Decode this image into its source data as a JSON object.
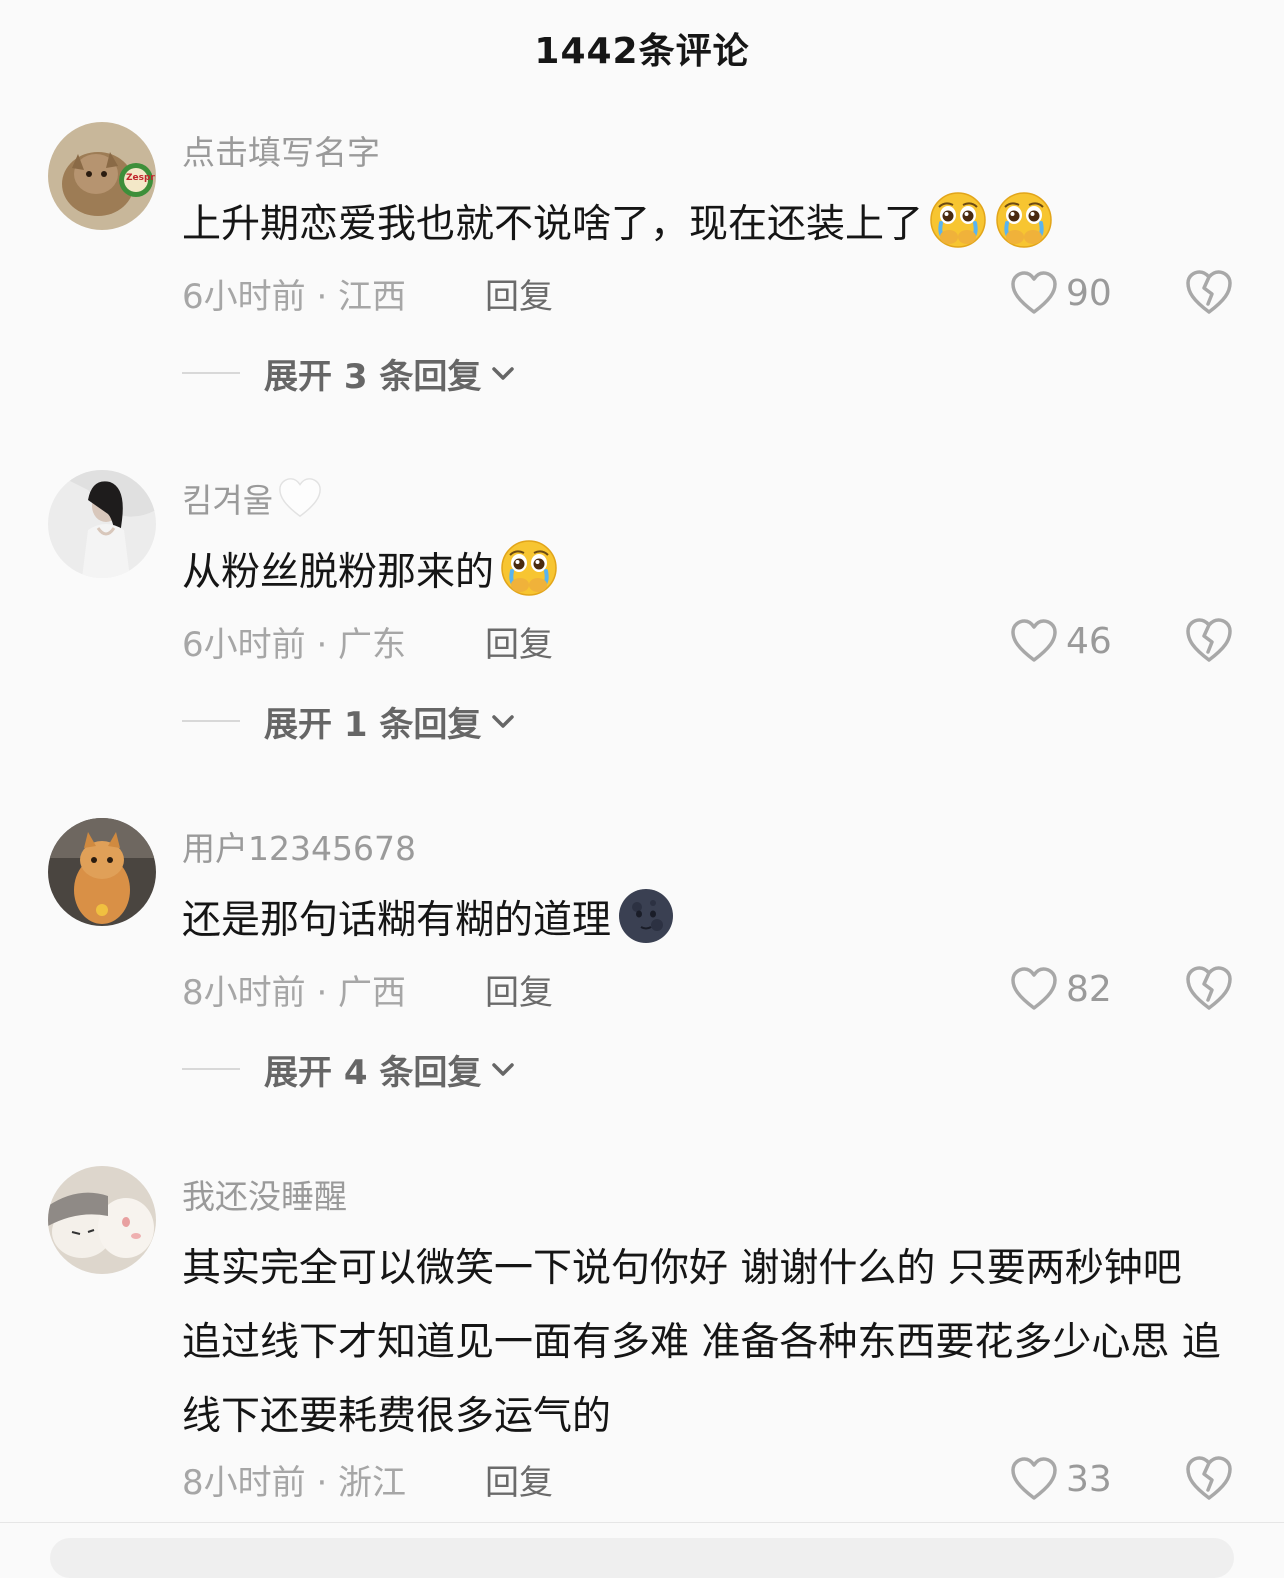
{
  "header": {
    "title": "1442条评论"
  },
  "comments": [
    {
      "username": "点击填写名字",
      "text": "上升期恋爱我也就不说啥了，现在还装上了",
      "emojis": [
        "pleading-face-icon",
        "pleading-face-icon"
      ],
      "time_location": "6小时前 · 江西",
      "reply_label": "回复",
      "likes": "90",
      "expand_label": "展开 3 条回复"
    },
    {
      "username": "킴겨울",
      "username_emoji": "white-heart-icon",
      "text": "从粉丝脱粉那来的",
      "emojis": [
        "pleading-face-icon"
      ],
      "time_location": "6小时前 · 广东",
      "reply_label": "回复",
      "likes": "46",
      "expand_label": "展开 1 条回复"
    },
    {
      "username": "用户12345678",
      "text": "还是那句话糊有糊的道理",
      "emojis": [
        "new-moon-face-icon"
      ],
      "time_location": "8小时前 · 广西",
      "reply_label": "回复",
      "likes": "82",
      "expand_label": "展开 4 条回复"
    },
    {
      "username": "我还没睡醒",
      "text": "其实完全可以微笑一下说句你好 谢谢什么的 只要两秒钟吧 追过线下才知道见一面有多难 准备各种东西要花多少心思 追线下还要耗费很多运气的",
      "time_location": "8小时前 · 浙江",
      "reply_label": "回复",
      "likes": "33"
    }
  ]
}
